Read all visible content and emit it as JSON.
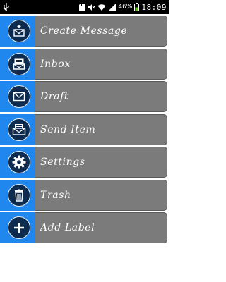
{
  "statusbar": {
    "battery_percent": "46%",
    "time": "18:09",
    "icons": [
      "usb-icon",
      "sd-card-icon",
      "mute-icon",
      "wifi-icon",
      "signal-icon",
      "battery-icon"
    ]
  },
  "menu": {
    "accent_color": "#1f87ee",
    "label_bg_color": "#7b7b7b",
    "items": [
      {
        "label": "Create Message",
        "icon": "compose-mail-icon"
      },
      {
        "label": "Inbox",
        "icon": "inbox-icon"
      },
      {
        "label": "Draft",
        "icon": "draft-mail-icon"
      },
      {
        "label": "Send Item",
        "icon": "sent-mail-icon"
      },
      {
        "label": "Settings",
        "icon": "settings-gear-icon"
      },
      {
        "label": "Trash",
        "icon": "trash-icon"
      },
      {
        "label": "Add Label",
        "icon": "add-icon"
      }
    ]
  }
}
